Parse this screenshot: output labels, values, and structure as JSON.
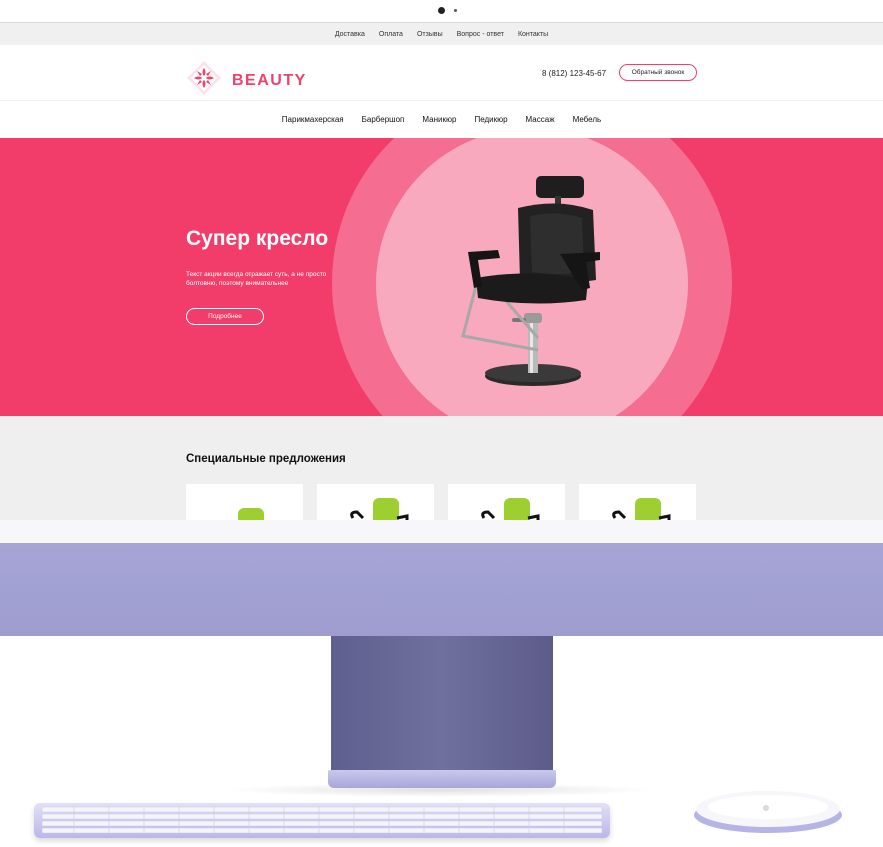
{
  "topbar": {
    "links": [
      "Доставка",
      "Оплата",
      "Отзывы",
      "Вопрос - ответ",
      "Контакты"
    ]
  },
  "header": {
    "logo_text": "BEAUTY",
    "phone": "8 (812) 123-45-67",
    "callback_label": "Обратный звонок"
  },
  "nav": {
    "items": [
      "Парикмахерская",
      "Барбершоп",
      "Маникюр",
      "Педикюр",
      "Массаж",
      "Мебель"
    ]
  },
  "hero": {
    "title": "Супер кресло",
    "text": "Текст акции всегда отражает суть, а не просто болтовню, поэтому внимательнее",
    "button_label": "Подробнее"
  },
  "special": {
    "title": "Специальные предложения"
  },
  "colors": {
    "accent": "#f0406c",
    "hero_bg": "#f23d6a",
    "monitor_purple": "#a6a5d6"
  },
  "icons": {
    "logo": "flower-logo-icon",
    "mouse_logo": "apple-logo-icon"
  }
}
